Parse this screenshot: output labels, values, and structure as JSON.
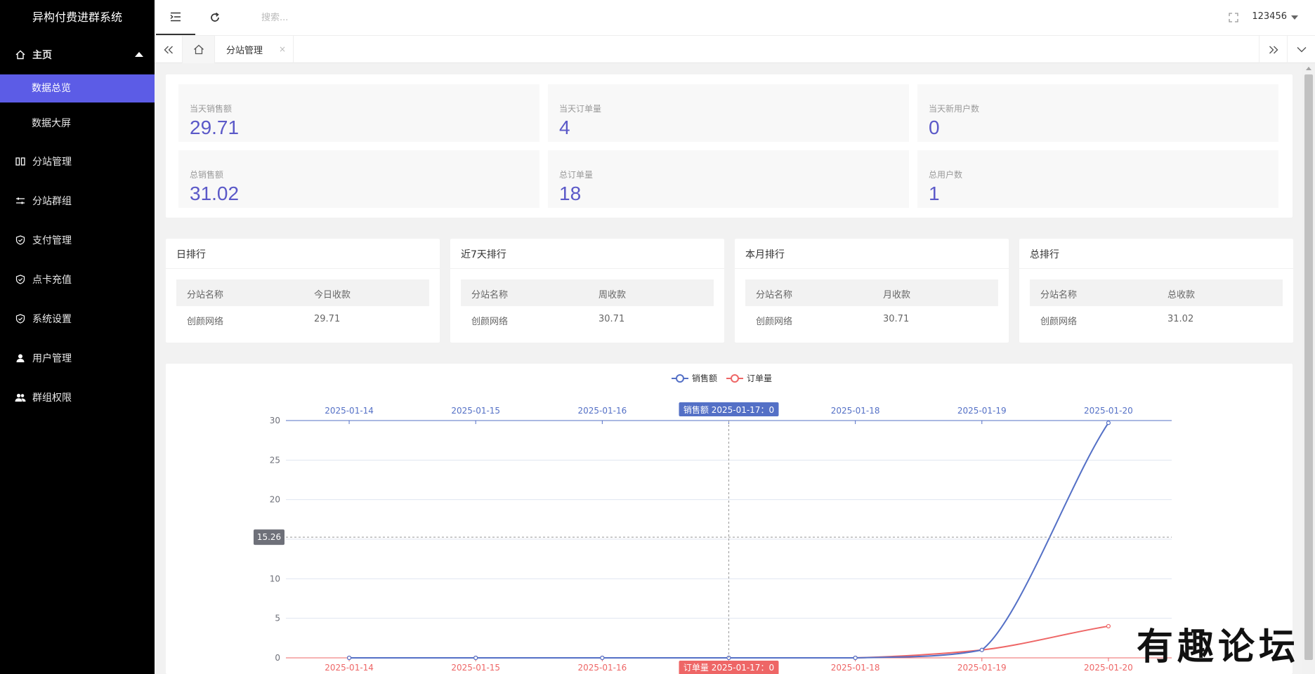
{
  "app": {
    "title": "异构付费进群系统"
  },
  "sidebar": {
    "home": {
      "label": "主页",
      "icon": "home-icon"
    },
    "sub_items": [
      {
        "label": "数据总览",
        "active": true
      },
      {
        "label": "数据大屏",
        "active": false
      }
    ],
    "items": [
      {
        "label": "分站管理",
        "icon": "columns-icon"
      },
      {
        "label": "分站群组",
        "icon": "sliders-icon"
      },
      {
        "label": "支付管理",
        "icon": "shield-check-icon"
      },
      {
        "label": "点卡充值",
        "icon": "shield-check-icon"
      },
      {
        "label": "系统设置",
        "icon": "shield-check-icon"
      },
      {
        "label": "用户管理",
        "icon": "user-icon"
      },
      {
        "label": "群组权限",
        "icon": "users-icon"
      }
    ]
  },
  "header": {
    "search_placeholder": "搜索...",
    "username": "123456"
  },
  "tabs": {
    "open_tab": "分站管理",
    "close_glyph": "×"
  },
  "stats": [
    {
      "label": "当天销售额",
      "value": "29.71"
    },
    {
      "label": "当天订单量",
      "value": "4"
    },
    {
      "label": "当天新用户数",
      "value": "0"
    },
    {
      "label": "总销售额",
      "value": "31.02"
    },
    {
      "label": "总订单量",
      "value": "18"
    },
    {
      "label": "总用户数",
      "value": "1"
    }
  ],
  "rankings": [
    {
      "title": "日排行",
      "col1": "分站名称",
      "col2": "今日收款",
      "row_name": "创颜网络",
      "row_value": "29.71"
    },
    {
      "title": "近7天排行",
      "col1": "分站名称",
      "col2": "周收款",
      "row_name": "创颜网络",
      "row_value": "30.71"
    },
    {
      "title": "本月排行",
      "col1": "分站名称",
      "col2": "月收款",
      "row_name": "创颜网络",
      "row_value": "30.71"
    },
    {
      "title": "总排行",
      "col1": "分站名称",
      "col2": "总收款",
      "row_name": "创颜网络",
      "row_value": "31.02"
    }
  ],
  "chart_data": {
    "type": "line",
    "x": [
      "2025-01-14",
      "2025-01-15",
      "2025-01-16",
      "2025-01-17",
      "2025-01-18",
      "2025-01-19",
      "2025-01-20"
    ],
    "series": [
      {
        "name": "销售额",
        "values": [
          0,
          0,
          0,
          0,
          0,
          1,
          29.71
        ],
        "color": "#5470c6"
      },
      {
        "name": "订单量",
        "values": [
          0,
          0,
          0,
          0,
          0,
          1,
          4
        ],
        "color": "#ee6666"
      }
    ],
    "ylim": [
      0,
      30
    ],
    "yticks": [
      0,
      5,
      10,
      15,
      20,
      25,
      30
    ],
    "grid": true,
    "legend": "top-center",
    "tooltip": {
      "top_label": "销售额  2025-01-17：0",
      "bottom_label": "订单量  2025-01-17：0",
      "y_pointer_label": "15.26",
      "x_index": 3,
      "y_value": 15.26
    }
  },
  "watermark": "有趣论坛"
}
